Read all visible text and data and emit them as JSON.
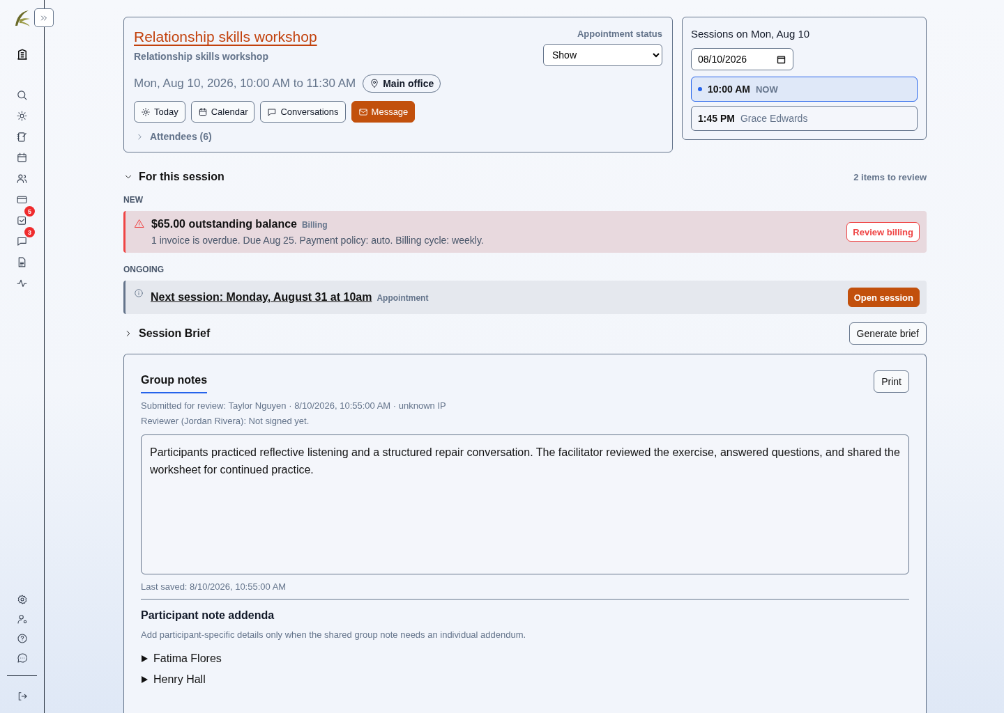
{
  "sidebar": {
    "tasks_badge": "5",
    "messages_badge": "3"
  },
  "appointment": {
    "title": "Relationship skills workshop",
    "subtitle": "Relationship skills workshop",
    "when": "Mon, Aug 10, 2026, 10:00 AM to 11:30 AM",
    "location": "Main office",
    "status_label": "Appointment status",
    "status_value": "Show",
    "actions": [
      {
        "label": "Today",
        "kind": "sun",
        "primary": false
      },
      {
        "label": "Calendar",
        "kind": "calendar",
        "primary": false
      },
      {
        "label": "Conversations",
        "kind": "chat",
        "primary": false
      },
      {
        "label": "Message",
        "kind": "mail",
        "primary": true
      }
    ],
    "attendees": {
      "label": "Attendees (6)",
      "expanded": false
    }
  },
  "sessions": {
    "title": "Sessions on Mon, Aug 10",
    "date": "08/10/2026",
    "items": [
      {
        "time": "10:00 AM",
        "detail": "NOW",
        "selected": true
      },
      {
        "time": "1:45 PM",
        "detail": "Grace Edwards",
        "selected": false
      }
    ]
  },
  "for_session": {
    "title": "For this session",
    "expanded": true,
    "count": "2 items to review",
    "groups": [
      {
        "label": "NEW",
        "items": [
          {
            "kind": "alert",
            "title": "$65.00 outstanding balance",
            "tag": "Billing",
            "text": "1 invoice is overdue. Due Aug 25. Payment policy: auto. Billing cycle: weekly.",
            "action": "Review billing"
          }
        ]
      },
      {
        "label": "ONGOING",
        "items": [
          {
            "kind": "info",
            "title": "Next session: Monday, August 31 at 10am",
            "tag": "Appointment",
            "action": "Open session"
          }
        ]
      }
    ]
  },
  "brief": {
    "title": "Session Brief",
    "expanded": false,
    "action": "Generate brief"
  },
  "notes": {
    "tab": "Group notes",
    "print": "Print",
    "submitted": "Submitted for review: Taylor Nguyen · 8/10/2026, 10:55:00 AM · unknown IP",
    "reviewer": "Reviewer (Jordan Rivera): Not signed yet.",
    "body": "Participants practiced reflective listening and a structured repair conversation. The facilitator reviewed the exercise, answered questions, and shared the worksheet for continued practice.",
    "saved": "Last saved: 8/10/2026, 10:55:00 AM",
    "addenda_title": "Participant note addenda",
    "addenda_hint": "Add participant-specific details only when the shared group note needs an individual addendum.",
    "participants": [
      {
        "name": "Fatima Flores",
        "expanded": false
      },
      {
        "name": "Henry Hall",
        "expanded": false
      }
    ]
  }
}
